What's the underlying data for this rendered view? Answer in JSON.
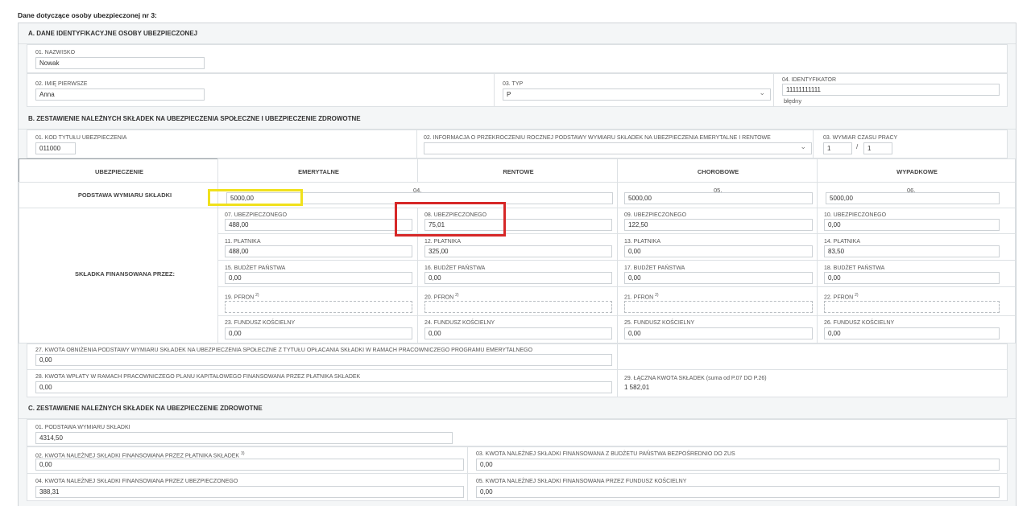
{
  "page_title": "Dane dotyczące osoby ubezpieczonej nr 3:",
  "section_a": {
    "title": "A. DANE IDENTYFIKACYJNE OSOBY UBEZPIECZONEJ",
    "nazwisko_label": "01. NAZWISKO",
    "nazwisko_value": "Nowak",
    "imie_label": "02. IMIĘ PIERWSZE",
    "imie_value": "Anna",
    "typ_label": "03. TYP",
    "typ_value": "P",
    "ident_label": "04. IDENTYFIKATOR",
    "ident_value": "11111111111",
    "ident_error": "błędny"
  },
  "section_b": {
    "title": "B. ZESTAWIENIE NALEŻNYCH SKŁADEK NA UBEZPIECZENIA SPOŁECZNE I UBEZPIECZENIE ZDROWOTNE",
    "kod_label": "01. KOD TYTUŁU UBEZPIECZENIA",
    "kod_value": "011000",
    "info_label": "02. INFORMACJA O PRZEKROCZENIU ROCZNEJ PODSTAWY WYMIARU SKŁADEK NA UBEZPIECZENIA EMERYTALNE I RENTOWE",
    "info_value": "",
    "wymiar_label": "03. WYMIAR CZASU PRACY",
    "wymiar_num": "1",
    "wymiar_sep": "/",
    "wymiar_den": "1",
    "headers": [
      "UBEZPIECZENIE",
      "EMERYTALNE",
      "RENTOWE",
      "CHOROBOWE",
      "WYPADKOWE"
    ],
    "podstawa_label": "PODSTAWA WYMIARU SKŁADKI",
    "podstawa_nums": [
      "04.",
      "05.",
      "06."
    ],
    "podstawa_values": [
      "5000,00",
      "5000,00",
      "5000,00"
    ],
    "skladka_label": "SKŁADKA FINANSOWANA PRZEZ:",
    "rows": [
      {
        "labels": [
          "07. UBEZPIECZONEGO",
          "08. UBEZPIECZONEGO",
          "09. UBEZPIECZONEGO",
          "10. UBEZPIECZONEGO"
        ],
        "values": [
          "488,00",
          "75,01",
          "122,50",
          "0,00"
        ]
      },
      {
        "labels": [
          "11. PŁATNIKA",
          "12. PŁATNIKA",
          "13. PŁATNIKA",
          "14. PŁATNIKA"
        ],
        "values": [
          "488,00",
          "325,00",
          "0,00",
          "83,50"
        ]
      },
      {
        "labels": [
          "15. BUDŻET PAŃSTWA",
          "16. BUDŻET PAŃSTWA",
          "17. BUDŻET PAŃSTWA",
          "18. BUDŻET PAŃSTWA"
        ],
        "values": [
          "0,00",
          "0,00",
          "0,00",
          "0,00"
        ]
      },
      {
        "labels": [
          "19. PFRON",
          "20. PFRON",
          "21. PFRON",
          "22. PFRON"
        ],
        "values": [
          "",
          "",
          "",
          ""
        ]
      },
      {
        "labels": [
          "23. FUNDUSZ KOŚCIELNY",
          "24. FUNDUSZ KOŚCIELNY",
          "25. FUNDUSZ KOŚCIELNY",
          "26. FUNDUSZ KOŚCIELNY"
        ],
        "values": [
          "0,00",
          "0,00",
          "0,00",
          "0,00"
        ]
      }
    ],
    "pfron_sup": "2)",
    "k27_label": "27. KWOTA OBNIŻENIA PODSTAWY WYMIARU SKŁADEK NA UBEZPIECZENIA SPOŁECZNE Z TYTUŁU OPŁACANIA SKŁADKI W RAMACH PRACOWNICZEGO PROGRAMU EMERYTALNEGO",
    "k27_value": "0,00",
    "k28_label": "28. KWOTA WPŁATY W RAMACH PRACOWNICZEGO PLANU KAPITAŁOWEGO FINANSOWANA PRZEZ PŁATNIKA SKŁADEK",
    "k28_value": "0,00",
    "k29_label": "29. ŁĄCZNA KWOTA SKŁADEK (suma od P.07 DO P.26)",
    "k29_value": "1 582,01"
  },
  "section_c": {
    "title": "C. ZESTAWIENIE NALEŻNYCH SKŁADEK NA UBEZPIECZENIE ZDROWOTNE",
    "c01_label": "01. PODSTAWA WYMIARU SKŁADKI",
    "c01_value": "4314,50",
    "c02_label": "02. KWOTA NALEŻNEJ SKŁADKI FINANSOWANA PRZEZ PŁATNIKA SKŁADEK",
    "c02_sup": "3)",
    "c02_value": "0,00",
    "c03_label": "03. KWOTA NALEŻNEJ SKŁADKI FINANSOWANA Z BUDŻETU PAŃSTWA BEZPOŚREDNIO DO ZUS",
    "c03_value": "0,00",
    "c04_label": "04. KWOTA NALEŻNEJ SKŁADKI FINANSOWANA PRZEZ UBEZPIECZONEGO",
    "c04_value": "388,31",
    "c05_label": "05. KWOTA NALEŻNEJ SKŁADKI FINANSOWANA PRZEZ FUNDUSZ KOŚCIELNY",
    "c05_value": "0,00"
  },
  "highlight_colors": {
    "yellow": "#f0e11c",
    "red": "#d62828"
  }
}
